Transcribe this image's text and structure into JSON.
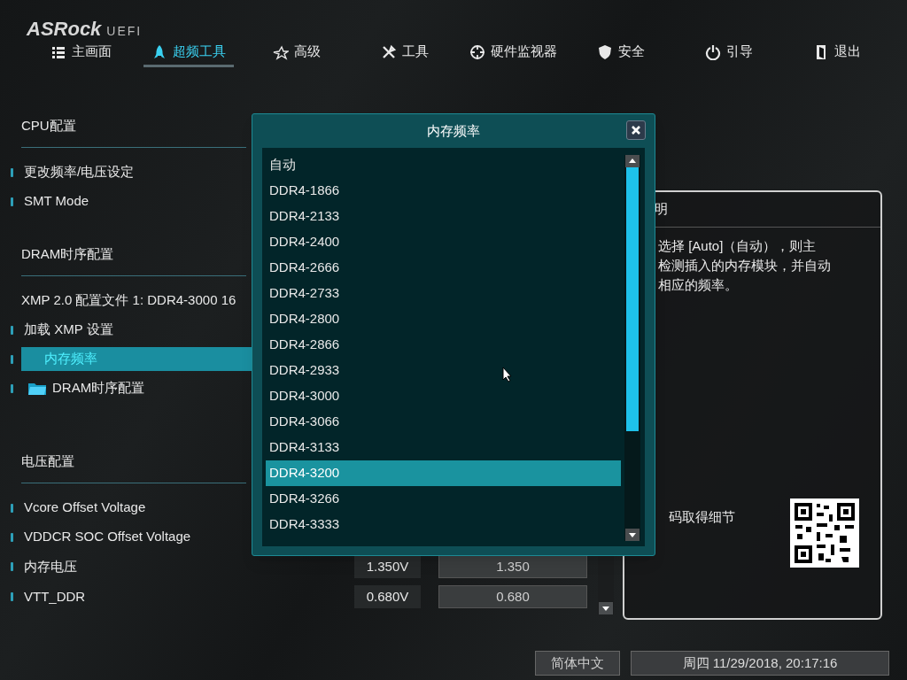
{
  "logo": {
    "brand": "ASRock",
    "suffix": "UEFI"
  },
  "tabs": [
    {
      "label": "主画面",
      "selected": false
    },
    {
      "label": "超频工具",
      "selected": true
    },
    {
      "label": "高级",
      "selected": false
    },
    {
      "label": "工具",
      "selected": false
    },
    {
      "label": "硬件监视器",
      "selected": false
    },
    {
      "label": "安全",
      "selected": false
    },
    {
      "label": "引导",
      "selected": false
    },
    {
      "label": "退出",
      "selected": false
    }
  ],
  "settings": [
    {
      "kind": "heading",
      "label": "CPU配置"
    },
    {
      "kind": "item",
      "label": "更改频率/电压设定",
      "selected": false
    },
    {
      "kind": "item",
      "label": "SMT Mode",
      "selected": false
    },
    {
      "kind": "heading",
      "label": "DRAM时序配置"
    },
    {
      "kind": "info",
      "label": "XMP 2.0 配置文件 1: DDR4-3000 16"
    },
    {
      "kind": "item",
      "label": "加载 XMP 设置",
      "selected": false
    },
    {
      "kind": "item",
      "label": "内存频率",
      "selected": true
    },
    {
      "kind": "folder",
      "label": "DRAM时序配置",
      "selected": false
    },
    {
      "kind": "heading",
      "label": "电压配置"
    },
    {
      "kind": "item",
      "label": "Vcore Offset Voltage",
      "selected": false
    },
    {
      "kind": "item",
      "label": "VDDCR SOC Offset Voltage",
      "selected": false
    },
    {
      "kind": "item",
      "label": "内存电压",
      "selected": false,
      "current": "1.350V",
      "value": "1.350"
    },
    {
      "kind": "item",
      "label": "VTT_DDR",
      "selected": false,
      "current": "0.680V",
      "value": "0.680"
    }
  ],
  "help": {
    "title": "明",
    "lines": [
      "选择 [Auto]（自动），则主",
      "检测插入的内存模块，并自动",
      "相应的频率。"
    ],
    "qr_text": "码取得细节"
  },
  "dialog": {
    "title": "内存频率",
    "options": [
      {
        "label": "自动",
        "selected": false
      },
      {
        "label": "DDR4-1866",
        "selected": false
      },
      {
        "label": "DDR4-2133",
        "selected": false
      },
      {
        "label": "DDR4-2400",
        "selected": false
      },
      {
        "label": "DDR4-2666",
        "selected": false
      },
      {
        "label": "DDR4-2733",
        "selected": false
      },
      {
        "label": "DDR4-2800",
        "selected": false
      },
      {
        "label": "DDR4-2866",
        "selected": false
      },
      {
        "label": "DDR4-2933",
        "selected": false
      },
      {
        "label": "DDR4-3000",
        "selected": false
      },
      {
        "label": "DDR4-3066",
        "selected": false
      },
      {
        "label": "DDR4-3133",
        "selected": false
      },
      {
        "label": "DDR4-3200",
        "selected": true
      },
      {
        "label": "DDR4-3266",
        "selected": false
      },
      {
        "label": "DDR4-3333",
        "selected": false
      }
    ]
  },
  "status_bar": {
    "language": "简体中文",
    "datetime": "周四 11/29/2018, 20:17:16"
  }
}
